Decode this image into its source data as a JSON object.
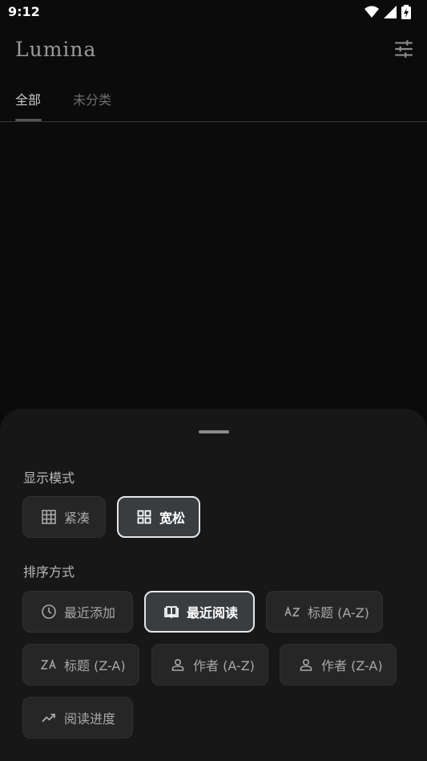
{
  "status_bar": {
    "time": "9:12"
  },
  "app": {
    "logo": "Lumina"
  },
  "tabs": [
    {
      "label": "全部",
      "active": true
    },
    {
      "label": "未分类",
      "active": false
    }
  ],
  "sheet": {
    "display_mode": {
      "title": "显示模式",
      "options": [
        {
          "label": "紧凑",
          "icon": "grid-icon",
          "selected": false
        },
        {
          "label": "宽松",
          "icon": "grid-large-icon",
          "selected": true
        }
      ]
    },
    "sort": {
      "title": "排序方式",
      "options": [
        {
          "label": "最近添加",
          "icon": "clock-icon",
          "selected": false
        },
        {
          "label": "最近阅读",
          "icon": "open-book-icon",
          "selected": true
        },
        {
          "label": "标题 (A-Z)",
          "icon": "sort-az-icon",
          "selected": false
        },
        {
          "label": "标题 (Z-A)",
          "icon": "sort-za-icon",
          "selected": false
        },
        {
          "label": "作者 (A-Z)",
          "icon": "person-icon",
          "selected": false
        },
        {
          "label": "作者 (Z-A)",
          "icon": "person-icon",
          "selected": false
        },
        {
          "label": "阅读进度",
          "icon": "trending-icon",
          "selected": false
        }
      ]
    }
  }
}
